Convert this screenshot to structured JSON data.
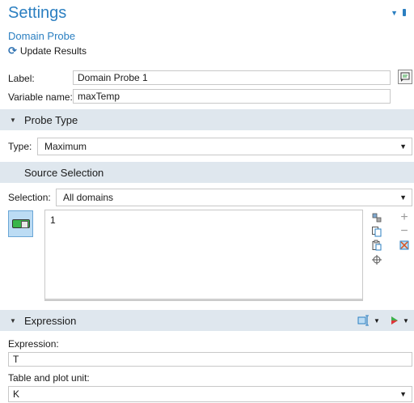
{
  "header": {
    "title": "Settings",
    "subtitle": "Domain Probe",
    "update_label": "Update Results"
  },
  "label_field": {
    "label": "Label:",
    "value": "Domain Probe 1"
  },
  "variable_field": {
    "label": "Variable name:",
    "value": "maxTemp"
  },
  "probe_type": {
    "section_title": "Probe Type",
    "type_label": "Type:",
    "type_value": "Maximum"
  },
  "source_selection": {
    "section_title": "Source Selection",
    "selection_label": "Selection:",
    "selection_value": "All domains",
    "items": [
      "1"
    ]
  },
  "expression": {
    "section_title": "Expression",
    "expression_label": "Expression:",
    "expression_value": "T",
    "unit_label": "Table and plot unit:",
    "unit_value": "K"
  },
  "colors": {
    "accent": "#2b7fc1",
    "section_bg": "#dfe7ee",
    "toggle_active": "#bcdcf4"
  }
}
